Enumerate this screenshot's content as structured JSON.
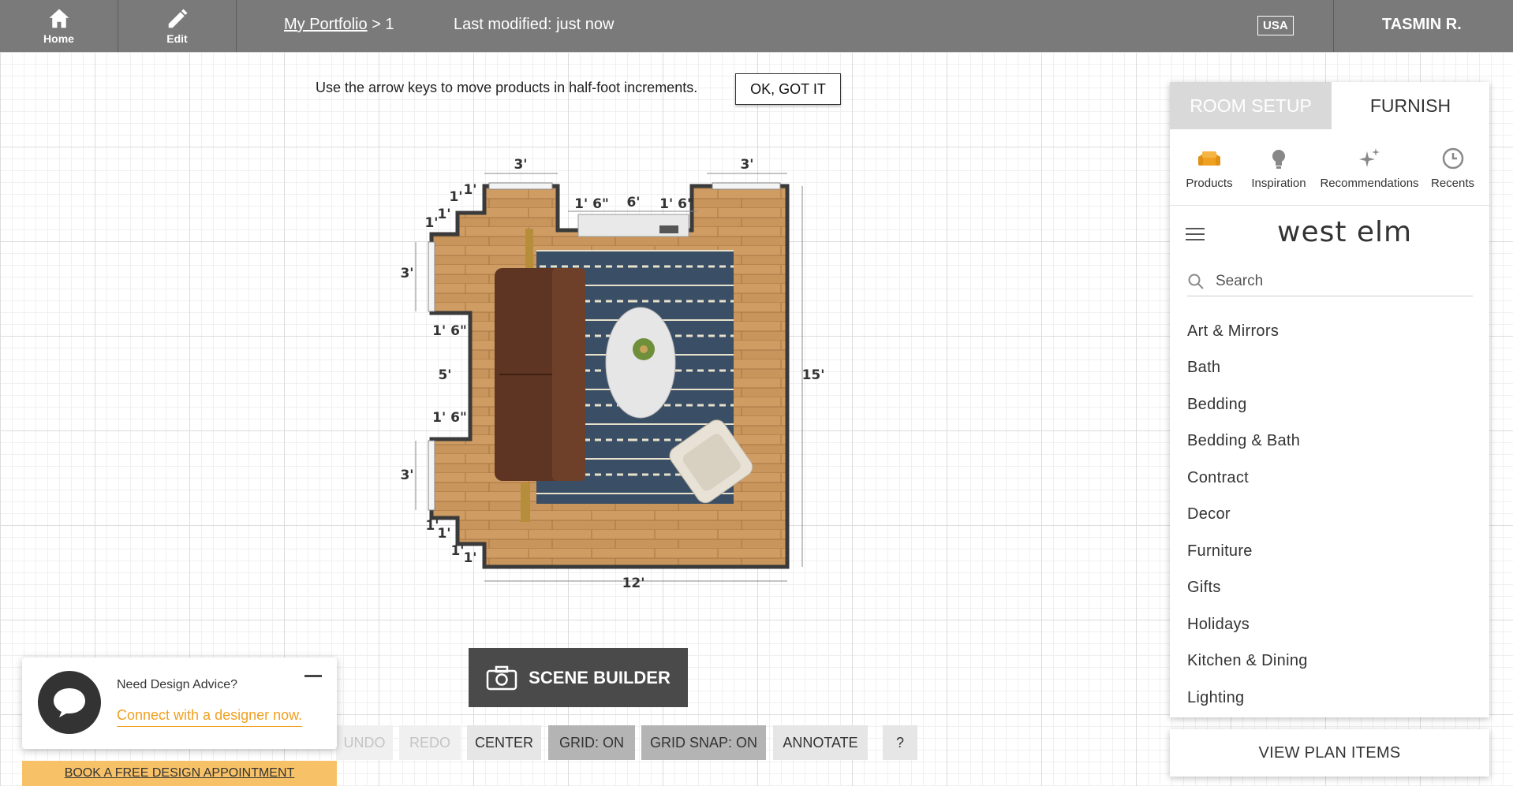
{
  "topbar": {
    "home_label": "Home",
    "edit_label": "Edit",
    "breadcrumb_portfolio": "My Portfolio",
    "breadcrumb_sep": " > 1",
    "modified": "Last modified: just now",
    "country": "USA",
    "user": "TASMIN R."
  },
  "tip": {
    "text": "Use the arrow keys to move products in half-foot increments.",
    "button": "OK, GOT IT"
  },
  "plan": {
    "dims": {
      "top_left_window": "3'",
      "top_right_window": "3'",
      "fireplace_left": "1' 6\"",
      "fireplace_mid": "6'",
      "fireplace_right": "1' 6\"",
      "corner_a1": "1'",
      "corner_a2": "1'",
      "corner_b1": "1'",
      "corner_b2": "1'",
      "left_window_top": "3'",
      "left_seg_1": "1' 6\"",
      "left_mid": "5'",
      "left_seg_2": "1' 6\"",
      "left_window_bottom": "3'",
      "corner_c1": "1'",
      "corner_c2": "1'",
      "corner_d1": "1'",
      "corner_d2": "1'",
      "right_height": "15'",
      "bottom_width": "12'"
    },
    "colors": {
      "floor": "#c8955c",
      "rug": "#3a4f66",
      "sofa": "#5e3523",
      "wall": "#3a3a3a"
    }
  },
  "scene_builder": {
    "label": "SCENE BUILDER",
    "icon": "camera-icon"
  },
  "toolbar": {
    "undo": "UNDO",
    "redo": "REDO",
    "center": "CENTER",
    "grid": "GRID: ON",
    "grid_snap": "GRID SNAP: ON",
    "annotate": "ANNOTATE",
    "help": "?"
  },
  "chat": {
    "title": "Need Design Advice?",
    "link": "Connect with a designer now.",
    "book": "BOOK A FREE DESIGN APPOINTMENT"
  },
  "panel": {
    "tab_room": "ROOM SETUP",
    "tab_furnish": "FURNISH",
    "categories": [
      {
        "label": "Products",
        "icon": "sofa-icon",
        "color": "#f0a020"
      },
      {
        "label": "Inspiration",
        "icon": "lightbulb-icon"
      },
      {
        "label": "Recommendations",
        "icon": "sparkle-icon"
      },
      {
        "label": "Recents",
        "icon": "clock-icon"
      }
    ],
    "brand": "west elm",
    "search_placeholder": "Search",
    "menu": [
      "Art & Mirrors",
      "Bath",
      "Bedding",
      "Bedding & Bath",
      "Contract",
      "Decor",
      "Furniture",
      "Gifts",
      "Holidays",
      "Kitchen & Dining",
      "Lighting"
    ],
    "view_plan": "VIEW PLAN ITEMS"
  }
}
